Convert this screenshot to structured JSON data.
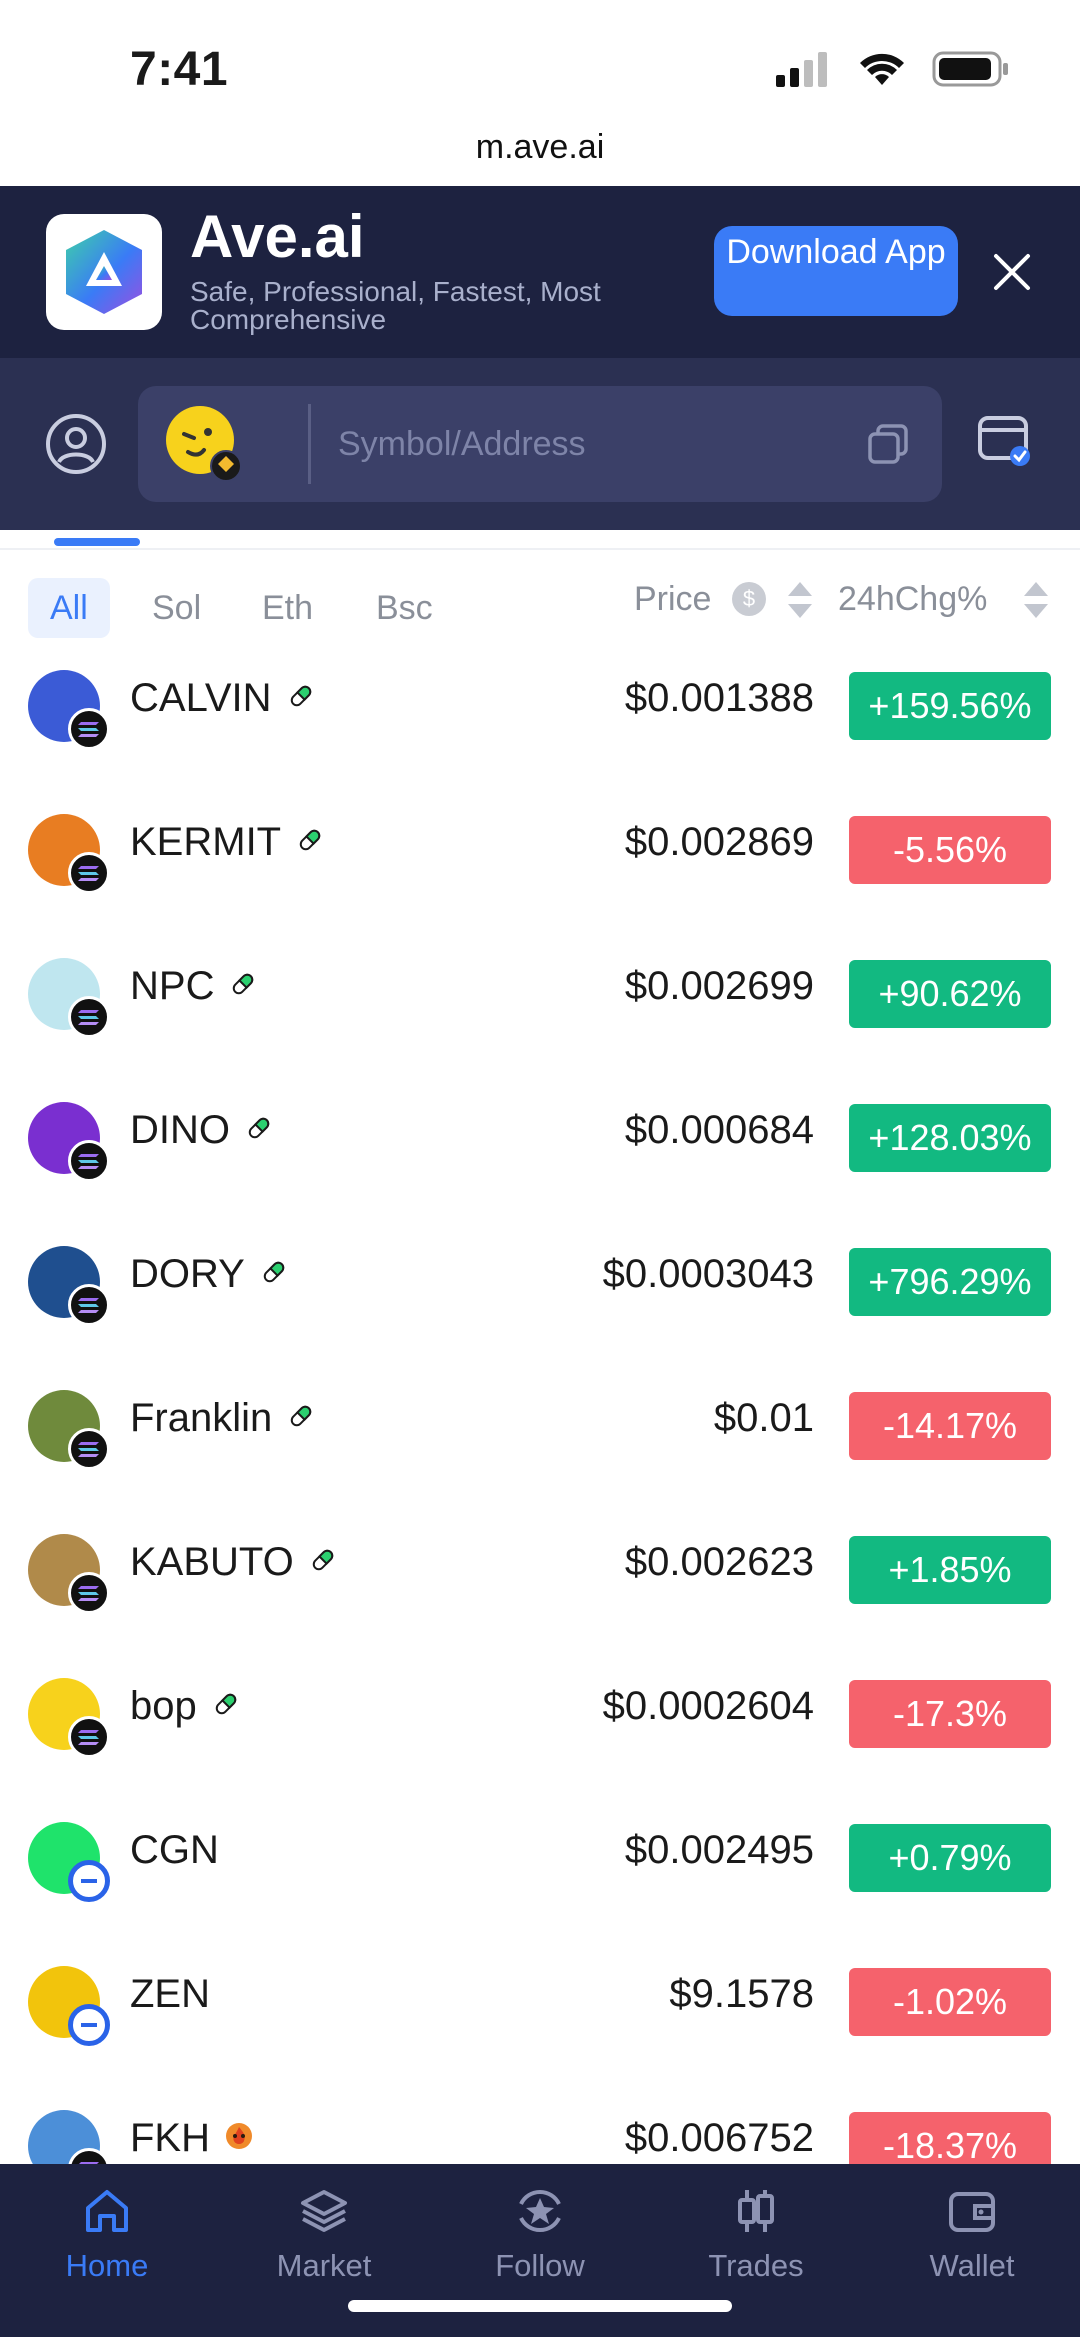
{
  "status_bar": {
    "time": "7:41"
  },
  "browser": {
    "url": "m.ave.ai"
  },
  "banner": {
    "title": "Ave.ai",
    "subtitle": "Safe, Professional, Fastest, Most Comprehensive",
    "download_label": "Download App"
  },
  "search": {
    "placeholder": "Symbol/Address"
  },
  "filters": {
    "chips": [
      "All",
      "Sol",
      "Eth",
      "Bsc"
    ],
    "active": "All",
    "price_label": "Price",
    "dollar_symbol": "$",
    "change_label": "24hChg%"
  },
  "tokens": [
    {
      "name": "CALVIN",
      "price": "$0.001388",
      "change": "+159.56%",
      "direction": "up",
      "chain": "sol",
      "tag": "pill",
      "avatar_color": "#3b5bd6"
    },
    {
      "name": "KERMIT",
      "price": "$0.002869",
      "change": "-5.56%",
      "direction": "down",
      "chain": "sol",
      "tag": "pill",
      "avatar_color": "#e87d22"
    },
    {
      "name": "NPC",
      "price": "$0.002699",
      "change": "+90.62%",
      "direction": "up",
      "chain": "sol",
      "tag": "pill",
      "avatar_color": "#bfe6ef"
    },
    {
      "name": "DINO",
      "price": "$0.000684",
      "change": "+128.03%",
      "direction": "up",
      "chain": "sol",
      "tag": "pill",
      "avatar_color": "#7a2fd0"
    },
    {
      "name": "DORY",
      "price": "$0.0003043",
      "change": "+796.29%",
      "direction": "up",
      "chain": "sol",
      "tag": "pill",
      "avatar_color": "#1f4f8f"
    },
    {
      "name": "Franklin",
      "price": "$0.01",
      "change": "-14.17%",
      "direction": "down",
      "chain": "sol",
      "tag": "pill",
      "avatar_color": "#6f8a3c"
    },
    {
      "name": "KABUTO",
      "price": "$0.002623",
      "change": "+1.85%",
      "direction": "up",
      "chain": "sol",
      "tag": "pill",
      "avatar_color": "#b08a4a"
    },
    {
      "name": "bop",
      "price": "$0.0002604",
      "change": "-17.3%",
      "direction": "down",
      "chain": "sol",
      "tag": "pill",
      "avatar_color": "#f7d21c"
    },
    {
      "name": "CGN",
      "price": "$0.002495",
      "change": "+0.79%",
      "direction": "up",
      "chain": "other",
      "tag": "none",
      "avatar_color": "#1fe36b"
    },
    {
      "name": "ZEN",
      "price": "$9.1578",
      "change": "-1.02%",
      "direction": "down",
      "chain": "other",
      "tag": "none",
      "avatar_color": "#f2c40c"
    },
    {
      "name": "FKH",
      "price": "$0.006752",
      "change": "-18.37%",
      "direction": "down",
      "chain": "sol",
      "tag": "fire",
      "avatar_color": "#4c8fd8"
    }
  ],
  "bottom_nav": [
    {
      "label": "Home",
      "icon": "home-icon",
      "active": true
    },
    {
      "label": "Market",
      "icon": "layers-icon",
      "active": false
    },
    {
      "label": "Follow",
      "icon": "star-icon",
      "active": false
    },
    {
      "label": "Trades",
      "icon": "candlestick-icon",
      "active": false
    },
    {
      "label": "Wallet",
      "icon": "wallet-icon",
      "active": false
    }
  ],
  "colors": {
    "accent": "#3a7bf6",
    "up": "#12b981",
    "down": "#f5626c",
    "banner_bg": "#1d2240",
    "header_bg": "#2b3052"
  }
}
